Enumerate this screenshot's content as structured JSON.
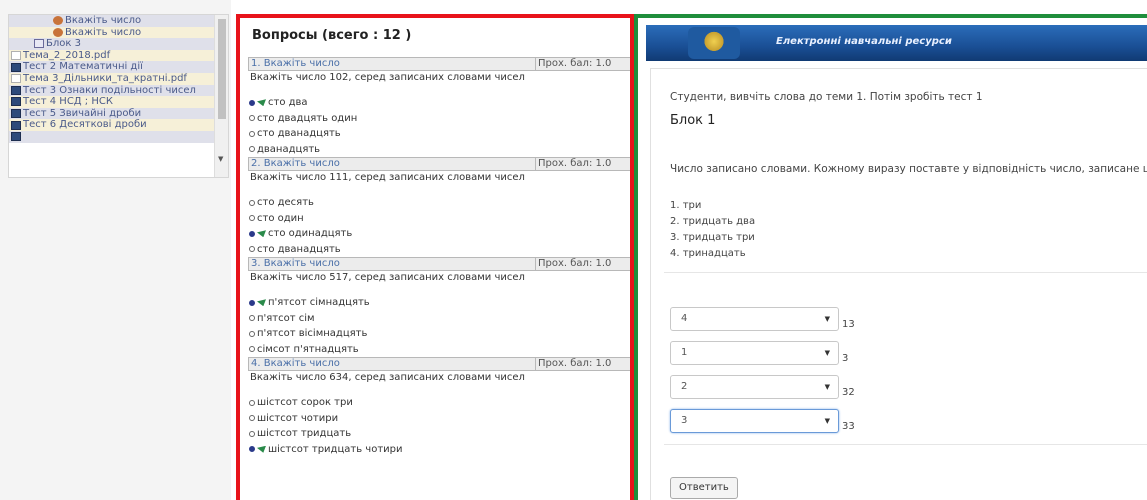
{
  "tree": {
    "items": [
      {
        "label": "Вкажіть число",
        "icon": "question-icon",
        "indent": 44,
        "style": "hl"
      },
      {
        "label": "Вкажіть число",
        "icon": "question-icon",
        "indent": 44,
        "style": "yl"
      },
      {
        "label": "Блок 3",
        "icon": "block-icon",
        "indent": 25,
        "style": "hl"
      },
      {
        "label": "Тема_2_2018.pdf",
        "icon": "pdf-icon",
        "indent": 2,
        "style": "yl"
      },
      {
        "label": "Тест 2 Математичні дії",
        "icon": "test-icon",
        "indent": 2,
        "style": "hl"
      },
      {
        "label": "Тема 3_Дільники_та_кратні.pdf",
        "icon": "pdf-icon",
        "indent": 2,
        "style": "yl"
      },
      {
        "label": "Тест 3 Ознаки подільності чисел",
        "icon": "test-icon",
        "indent": 2,
        "style": "hl"
      },
      {
        "label": "Тест 4 НСД ; НСК",
        "icon": "test-icon",
        "indent": 2,
        "style": "yl"
      },
      {
        "label": "Тест 5 Звичайні дроби",
        "icon": "test-icon",
        "indent": 2,
        "style": "hl"
      },
      {
        "label": "Тест 6 Десяткові дроби",
        "icon": "test-icon",
        "indent": 2,
        "style": "yl"
      },
      {
        "label": "",
        "icon": "test-icon",
        "indent": 2,
        "style": "hl"
      }
    ]
  },
  "questions_panel": {
    "title": "Вопросы (всего : 12 )",
    "questions": [
      {
        "number_label": "1. Вкажіть число",
        "score": "Прох. бал: 1.0",
        "text": "Вкажіть число    102,  серед записаних словами чисел",
        "options": [
          {
            "text": "сто два",
            "correct": true
          },
          {
            "text": "сто двадцять один",
            "correct": false
          },
          {
            "text": "сто дванадцять",
            "correct": false
          },
          {
            "text": "дванадцять",
            "correct": false
          }
        ]
      },
      {
        "number_label": "2. Вкажіть число",
        "score": "Прох. бал: 1.0",
        "text": "Вкажіть число   111, серед записаних словами чисел",
        "options": [
          {
            "text": "сто десять",
            "correct": false
          },
          {
            "text": "сто один",
            "correct": false
          },
          {
            "text": "сто одинадцять",
            "correct": true
          },
          {
            "text": "сто дванадцять",
            "correct": false
          }
        ]
      },
      {
        "number_label": "3. Вкажіть число",
        "score": "Прох. бал: 1.0",
        "text": "Вкажіть число    517, серед записаних словами чисел",
        "options": [
          {
            "text": "п'ятсот сімнадцять",
            "correct": true
          },
          {
            "text": "п'ятсот сім",
            "correct": false
          },
          {
            "text": "п'ятсот вісімнадцять",
            "correct": false
          },
          {
            "text": "сімсот п'ятнадцять",
            "correct": false
          }
        ]
      },
      {
        "number_label": "4. Вкажіть число",
        "score": "Прох. бал: 1.0",
        "text": "Вкажіть число   634, серед записаних словами чисел",
        "options": [
          {
            "text": "шістсот сорок три",
            "correct": false
          },
          {
            "text": "шістсот чотири",
            "correct": false
          },
          {
            "text": "шістсот тридцать",
            "correct": false
          },
          {
            "text": "шістсот тридцать чотири",
            "correct": true
          }
        ]
      }
    ]
  },
  "test": {
    "banner_title": "Електронні навчальні ресурси",
    "intro": "Студенти, вивчіть слова до теми 1. Потім зробіть тест 1",
    "block_title": "Блок 1",
    "task": "Число записано словами. Кожному виразу поставте у відповідність число, записане цифрами:",
    "words": [
      "1.  три",
      "2.  тридцать два",
      "3.  тридцать три",
      "4.  тринадцать"
    ],
    "matches": [
      {
        "selected": "4",
        "number": "13",
        "focused": false
      },
      {
        "selected": "1",
        "number": "3",
        "focused": false
      },
      {
        "selected": "2",
        "number": "32",
        "focused": false
      },
      {
        "selected": "3",
        "number": "33",
        "focused": true
      }
    ],
    "submit_label": "Ответить"
  },
  "colors": {
    "questions_border": "#e8131a",
    "test_border": "#1f8e3c",
    "banner": "#1a4f95"
  }
}
